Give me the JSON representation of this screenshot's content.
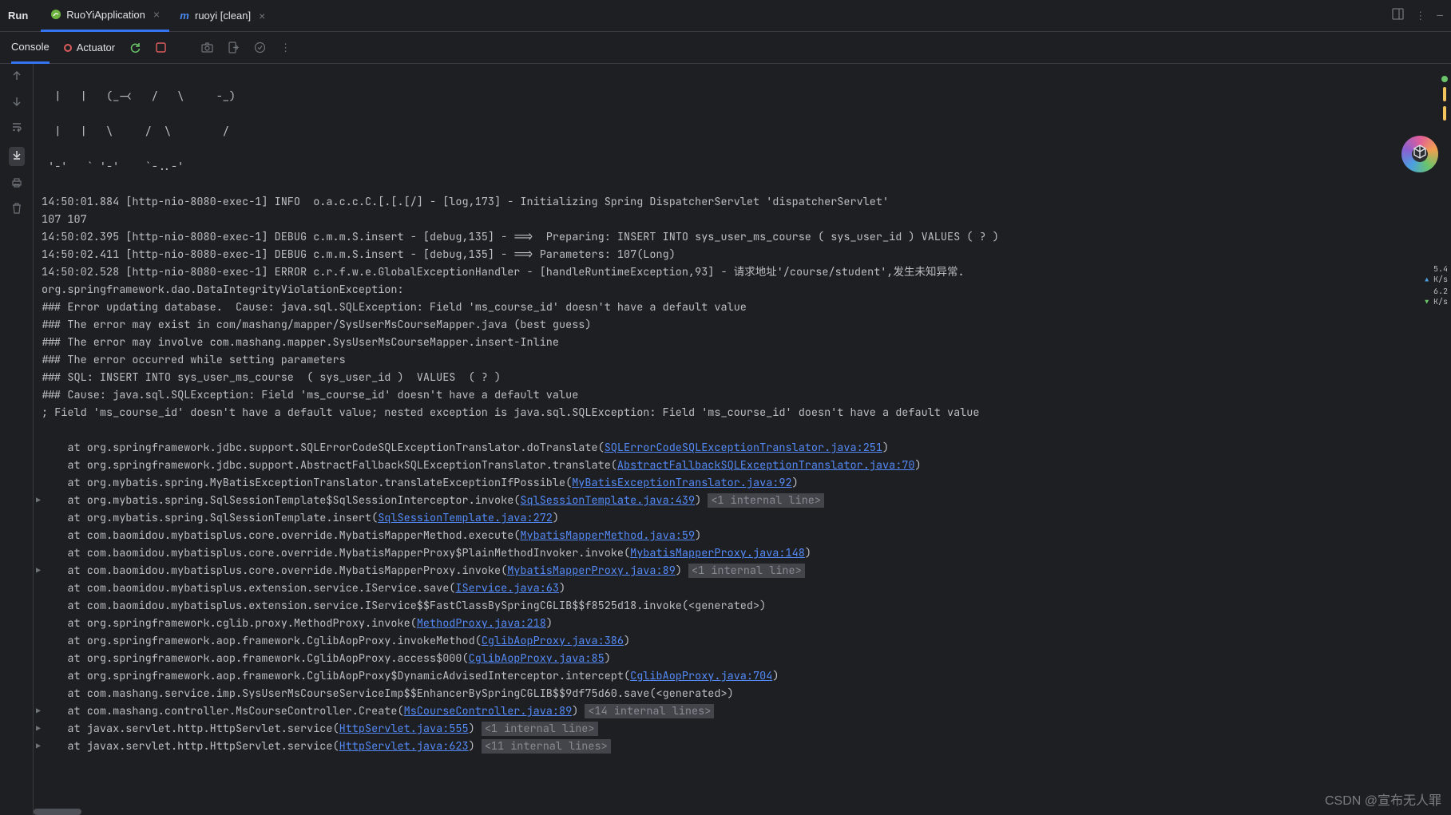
{
  "topbar": {
    "run_label": "Run",
    "tabs": [
      {
        "icon": "spring",
        "label": "RuoYiApplication",
        "active": true
      },
      {
        "icon": "maven",
        "label": "ruoyi [clean]",
        "active": false
      }
    ]
  },
  "toolbar": {
    "console_label": "Console",
    "actuator_label": "Actuator"
  },
  "speed": {
    "up": "5.4",
    "down": "6.2",
    "unit": "K/s"
  },
  "watermark": "CSDN @宣布无人罪",
  "console": {
    "ascii1": "  |   |   (_-<   /   \\     -_)",
    "ascii2": "  |   |   \\     /  \\        /",
    "ascii3": " '-'   ` '-'    `-..-'",
    "lines": [
      {
        "text": "14:50:01.884 [http-nio-8080-exec-1] INFO  o.a.c.c.C.[.[.[/] - [log,173] - Initializing Spring DispatcherServlet 'dispatcherServlet'"
      },
      {
        "text": "107 107"
      },
      {
        "text": "14:50:02.395 [http-nio-8080-exec-1] DEBUG c.m.m.S.insert - [debug,135] - ==>  Preparing: INSERT INTO sys_user_ms_course ( sys_user_id ) VALUES ( ? )"
      },
      {
        "text": "14:50:02.411 [http-nio-8080-exec-1] DEBUG c.m.m.S.insert - [debug,135] - ==> Parameters: 107(Long)"
      },
      {
        "text": "14:50:02.528 [http-nio-8080-exec-1] ERROR c.r.f.w.e.GlobalExceptionHandler - [handleRuntimeException,93] - 请求地址'/course/student',发生未知异常."
      },
      {
        "text": "org.springframework.dao.DataIntegrityViolationException:"
      },
      {
        "text": "### Error updating database.  Cause: java.sql.SQLException: Field 'ms_course_id' doesn't have a default value"
      },
      {
        "text": "### The error may exist in com/mashang/mapper/SysUserMsCourseMapper.java (best guess)"
      },
      {
        "text": "### The error may involve com.mashang.mapper.SysUserMsCourseMapper.insert-Inline"
      },
      {
        "text": "### The error occurred while setting parameters"
      },
      {
        "text": "### SQL: INSERT INTO sys_user_ms_course  ( sys_user_id )  VALUES  ( ? )"
      },
      {
        "text": "### Cause: java.sql.SQLException: Field 'ms_course_id' doesn't have a default value"
      },
      {
        "text": "; Field 'ms_course_id' doesn't have a default value; nested exception is java.sql.SQLException: Field 'ms_course_id' doesn't have a default value"
      }
    ],
    "stack": [
      {
        "pre": "    at org.springframework.jdbc.support.SQLErrorCodeSQLExceptionTranslator.doTranslate(",
        "link": "SQLErrorCodeSQLExceptionTranslator.java:251",
        "post": ")"
      },
      {
        "pre": "    at org.springframework.jdbc.support.AbstractFallbackSQLExceptionTranslator.translate(",
        "link": "AbstractFallbackSQLExceptionTranslator.java:70",
        "post": ")"
      },
      {
        "pre": "    at org.mybatis.spring.MyBatisExceptionTranslator.translateExceptionIfPossible(",
        "link": "MyBatisExceptionTranslator.java:92",
        "post": ")"
      },
      {
        "chevron": true,
        "pre": "    at org.mybatis.spring.SqlSessionTemplate$SqlSessionInterceptor.invoke(",
        "link": "SqlSessionTemplate.java:439",
        "post": ") ",
        "hint": "<1 internal line>"
      },
      {
        "pre": "    at org.mybatis.spring.SqlSessionTemplate.insert(",
        "link": "SqlSessionTemplate.java:272",
        "post": ")"
      },
      {
        "pre": "    at com.baomidou.mybatisplus.core.override.MybatisMapperMethod.execute(",
        "link": "MybatisMapperMethod.java:59",
        "post": ")"
      },
      {
        "pre": "    at com.baomidou.mybatisplus.core.override.MybatisMapperProxy$PlainMethodInvoker.invoke(",
        "link": "MybatisMapperProxy.java:148",
        "post": ")"
      },
      {
        "chevron": true,
        "pre": "    at com.baomidou.mybatisplus.core.override.MybatisMapperProxy.invoke(",
        "link": "MybatisMapperProxy.java:89",
        "post": ") ",
        "hint": "<1 internal line>"
      },
      {
        "pre": "    at com.baomidou.mybatisplus.extension.service.IService.save(",
        "link": "IService.java:63",
        "post": ")"
      },
      {
        "pre": "    at com.baomidou.mybatisplus.extension.service.IService$$FastClassBySpringCGLIB$$f8525d18.invoke(<generated>)",
        "link": "",
        "post": ""
      },
      {
        "pre": "    at org.springframework.cglib.proxy.MethodProxy.invoke(",
        "link": "MethodProxy.java:218",
        "post": ")"
      },
      {
        "pre": "    at org.springframework.aop.framework.CglibAopProxy.invokeMethod(",
        "link": "CglibAopProxy.java:386",
        "post": ")"
      },
      {
        "pre": "    at org.springframework.aop.framework.CglibAopProxy.access$000(",
        "link": "CglibAopProxy.java:85",
        "post": ")"
      },
      {
        "pre": "    at org.springframework.aop.framework.CglibAopProxy$DynamicAdvisedInterceptor.intercept(",
        "link": "CglibAopProxy.java:704",
        "post": ")"
      },
      {
        "pre": "    at com.mashang.service.imp.SysUserMsCourseServiceImp$$EnhancerBySpringCGLIB$$9df75d60.save(<generated>)",
        "link": "",
        "post": ""
      },
      {
        "chevron": true,
        "pre": "    at com.mashang.controller.MsCourseController.Create(",
        "link": "MsCourseController.java:89",
        "post": ") ",
        "hint": "<14 internal lines>"
      },
      {
        "chevron": true,
        "pre": "    at javax.servlet.http.HttpServlet.service(",
        "link": "HttpServlet.java:555",
        "post": ") ",
        "hint": "<1 internal line>"
      },
      {
        "chevron": true,
        "pre": "    at javax.servlet.http.HttpServlet.service(",
        "link": "HttpServlet.java:623",
        "post": ") ",
        "hint": "<11 internal lines>"
      }
    ]
  }
}
